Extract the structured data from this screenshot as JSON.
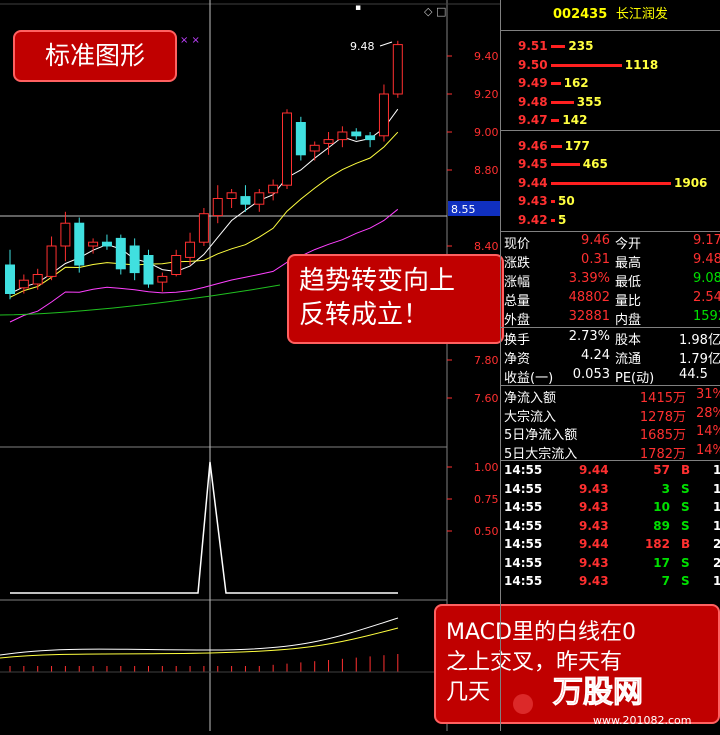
{
  "stock": {
    "code": "002435",
    "name": "长江润发"
  },
  "order_book": {
    "asks": [
      {
        "price": "9.51",
        "volume": "235",
        "ratio": 0.12
      },
      {
        "price": "9.50",
        "volume": "1118",
        "ratio": 0.59
      },
      {
        "price": "9.49",
        "volume": "162",
        "ratio": 0.08
      },
      {
        "price": "9.48",
        "volume": "355",
        "ratio": 0.19
      },
      {
        "price": "9.47",
        "volume": "142",
        "ratio": 0.07
      }
    ],
    "bids": [
      {
        "price": "9.46",
        "volume": "177",
        "ratio": 0.09
      },
      {
        "price": "9.45",
        "volume": "465",
        "ratio": 0.24
      },
      {
        "price": "9.44",
        "volume": "1906",
        "ratio": 1.0
      },
      {
        "price": "9.43",
        "volume": "50",
        "ratio": 0.02
      },
      {
        "price": "9.42",
        "volume": "5",
        "ratio": 0.005
      }
    ]
  },
  "quotes": [
    {
      "l1": "现价",
      "v1": "9.46",
      "c1": "red",
      "l2": "今开",
      "v2": "9.17",
      "c2": "red"
    },
    {
      "l1": "涨跌",
      "v1": "0.31",
      "c1": "red",
      "l2": "最高",
      "v2": "9.48",
      "c2": "red"
    },
    {
      "l1": "涨幅",
      "v1": "3.39%",
      "c1": "red",
      "l2": "最低",
      "v2": "9.08",
      "c2": "green"
    },
    {
      "l1": "总量",
      "v1": "48802",
      "c1": "red",
      "l2": "量比",
      "v2": "2.54",
      "c2": "red"
    },
    {
      "l1": "外盘",
      "v1": "32881",
      "c1": "red",
      "l2": "内盘",
      "v2": "15921",
      "c2": "green"
    }
  ],
  "stats": [
    {
      "l1": "换手",
      "v1": "2.73%",
      "l2": "股本",
      "v2": "1.98亿"
    },
    {
      "l1": "净资",
      "v1": "4.24",
      "l2": "流通",
      "v2": "1.79亿"
    },
    {
      "l1": "收益(一)",
      "v1": "0.053",
      "l2": "PE(动)",
      "v2": "44.5"
    }
  ],
  "flows": [
    {
      "label": "净流入额",
      "value": "1415万",
      "pct": "31%"
    },
    {
      "label": "大宗流入",
      "value": "1278万",
      "pct": "28%"
    },
    {
      "label": "5日净流入额",
      "value": "1685万",
      "pct": "14%"
    },
    {
      "label": "5日大宗流入",
      "value": "1782万",
      "pct": "14%"
    }
  ],
  "ticks": [
    {
      "time": "14:55",
      "price": "9.44",
      "vol": "57",
      "side": "B",
      "extra": "1"
    },
    {
      "time": "14:55",
      "price": "9.43",
      "vol": "3",
      "side": "S",
      "extra": "1"
    },
    {
      "time": "14:55",
      "price": "9.43",
      "vol": "10",
      "side": "S",
      "extra": "1"
    },
    {
      "time": "14:55",
      "price": "9.43",
      "vol": "89",
      "side": "S",
      "extra": "1"
    },
    {
      "time": "14:55",
      "price": "9.44",
      "vol": "182",
      "side": "B",
      "extra": "2"
    },
    {
      "time": "14:55",
      "price": "9.43",
      "vol": "17",
      "side": "S",
      "extra": "2"
    },
    {
      "time": "14:55",
      "price": "9.43",
      "vol": "7",
      "side": "S",
      "extra": "1"
    }
  ],
  "chart": {
    "price_axis": [
      "9.40",
      "9.20",
      "9.00",
      "8.80",
      "8.40",
      "7.80",
      "7.60"
    ],
    "price_levels": [
      9.4,
      9.2,
      9.0,
      8.8,
      8.4,
      7.8,
      7.6
    ],
    "current_price_marker": "8.55",
    "high_label": "9.48",
    "indicator_axis": [
      "1.00",
      "0.75",
      "0.50"
    ],
    "indicator_levels": [
      1.0,
      0.75,
      0.5
    ],
    "candles": [
      {
        "o": 8.3,
        "h": 8.38,
        "l": 8.12,
        "c": 8.15
      },
      {
        "o": 8.18,
        "h": 8.25,
        "l": 8.15,
        "c": 8.22
      },
      {
        "o": 8.2,
        "h": 8.28,
        "l": 8.17,
        "c": 8.25
      },
      {
        "o": 8.24,
        "h": 8.45,
        "l": 8.22,
        "c": 8.4
      },
      {
        "o": 8.4,
        "h": 8.58,
        "l": 8.32,
        "c": 8.52
      },
      {
        "o": 8.52,
        "h": 8.55,
        "l": 8.26,
        "c": 8.3
      },
      {
        "o": 8.4,
        "h": 8.44,
        "l": 8.36,
        "c": 8.42
      },
      {
        "o": 8.42,
        "h": 8.46,
        "l": 8.38,
        "c": 8.4
      },
      {
        "o": 8.44,
        "h": 8.46,
        "l": 8.25,
        "c": 8.28
      },
      {
        "o": 8.4,
        "h": 8.44,
        "l": 8.22,
        "c": 8.26
      },
      {
        "o": 8.35,
        "h": 8.38,
        "l": 8.18,
        "c": 8.2
      },
      {
        "o": 8.21,
        "h": 8.26,
        "l": 8.16,
        "c": 8.24
      },
      {
        "o": 8.25,
        "h": 8.38,
        "l": 8.24,
        "c": 8.35
      },
      {
        "o": 8.34,
        "h": 8.47,
        "l": 8.3,
        "c": 8.42
      },
      {
        "o": 8.42,
        "h": 8.6,
        "l": 8.4,
        "c": 8.57
      },
      {
        "o": 8.56,
        "h": 8.72,
        "l": 8.52,
        "c": 8.65
      },
      {
        "o": 8.65,
        "h": 8.7,
        "l": 8.6,
        "c": 8.68
      },
      {
        "o": 8.66,
        "h": 8.72,
        "l": 8.58,
        "c": 8.62
      },
      {
        "o": 8.62,
        "h": 8.7,
        "l": 8.58,
        "c": 8.68
      },
      {
        "o": 8.68,
        "h": 8.75,
        "l": 8.64,
        "c": 8.72
      },
      {
        "o": 8.72,
        "h": 9.12,
        "l": 8.7,
        "c": 9.1
      },
      {
        "o": 9.05,
        "h": 9.08,
        "l": 8.85,
        "c": 8.88
      },
      {
        "o": 8.9,
        "h": 8.95,
        "l": 8.85,
        "c": 8.93
      },
      {
        "o": 8.94,
        "h": 9.0,
        "l": 8.88,
        "c": 8.96
      },
      {
        "o": 8.96,
        "h": 9.03,
        "l": 8.92,
        "c": 9.0
      },
      {
        "o": 9.0,
        "h": 9.02,
        "l": 8.96,
        "c": 8.98
      },
      {
        "o": 8.98,
        "h": 9.0,
        "l": 8.92,
        "c": 8.96
      },
      {
        "o": 8.98,
        "h": 9.25,
        "l": 8.95,
        "c": 9.2
      },
      {
        "o": 9.2,
        "h": 9.48,
        "l": 9.18,
        "c": 9.46
      }
    ]
  },
  "annotations": {
    "top_left": "标准图形",
    "mid_right": "趋势转变向上\n反转成立！",
    "bottom_right": "MACD里的白线在0\n之上交叉，昨天有\n几天"
  },
  "watermark": {
    "brand": "万股网",
    "url": "www.201082.com"
  }
}
